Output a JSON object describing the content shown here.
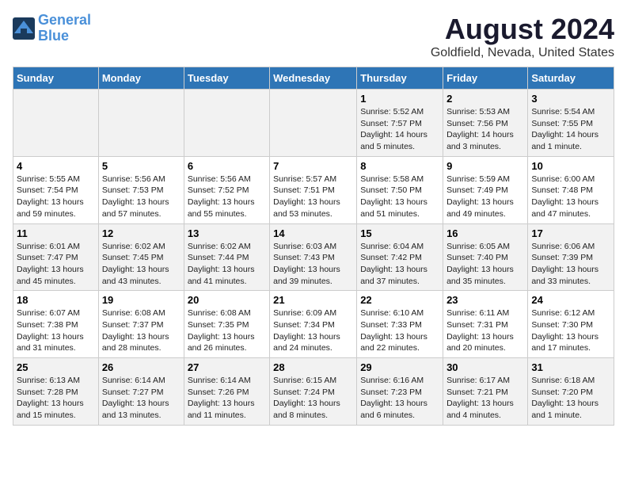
{
  "header": {
    "logo_line1": "General",
    "logo_line2": "Blue",
    "main_title": "August 2024",
    "subtitle": "Goldfield, Nevada, United States"
  },
  "days_of_week": [
    "Sunday",
    "Monday",
    "Tuesday",
    "Wednesday",
    "Thursday",
    "Friday",
    "Saturday"
  ],
  "weeks": [
    [
      {
        "day": "",
        "detail": ""
      },
      {
        "day": "",
        "detail": ""
      },
      {
        "day": "",
        "detail": ""
      },
      {
        "day": "",
        "detail": ""
      },
      {
        "day": "1",
        "detail": "Sunrise: 5:52 AM\nSunset: 7:57 PM\nDaylight: 14 hours\nand 5 minutes."
      },
      {
        "day": "2",
        "detail": "Sunrise: 5:53 AM\nSunset: 7:56 PM\nDaylight: 14 hours\nand 3 minutes."
      },
      {
        "day": "3",
        "detail": "Sunrise: 5:54 AM\nSunset: 7:55 PM\nDaylight: 14 hours\nand 1 minute."
      }
    ],
    [
      {
        "day": "4",
        "detail": "Sunrise: 5:55 AM\nSunset: 7:54 PM\nDaylight: 13 hours\nand 59 minutes."
      },
      {
        "day": "5",
        "detail": "Sunrise: 5:56 AM\nSunset: 7:53 PM\nDaylight: 13 hours\nand 57 minutes."
      },
      {
        "day": "6",
        "detail": "Sunrise: 5:56 AM\nSunset: 7:52 PM\nDaylight: 13 hours\nand 55 minutes."
      },
      {
        "day": "7",
        "detail": "Sunrise: 5:57 AM\nSunset: 7:51 PM\nDaylight: 13 hours\nand 53 minutes."
      },
      {
        "day": "8",
        "detail": "Sunrise: 5:58 AM\nSunset: 7:50 PM\nDaylight: 13 hours\nand 51 minutes."
      },
      {
        "day": "9",
        "detail": "Sunrise: 5:59 AM\nSunset: 7:49 PM\nDaylight: 13 hours\nand 49 minutes."
      },
      {
        "day": "10",
        "detail": "Sunrise: 6:00 AM\nSunset: 7:48 PM\nDaylight: 13 hours\nand 47 minutes."
      }
    ],
    [
      {
        "day": "11",
        "detail": "Sunrise: 6:01 AM\nSunset: 7:47 PM\nDaylight: 13 hours\nand 45 minutes."
      },
      {
        "day": "12",
        "detail": "Sunrise: 6:02 AM\nSunset: 7:45 PM\nDaylight: 13 hours\nand 43 minutes."
      },
      {
        "day": "13",
        "detail": "Sunrise: 6:02 AM\nSunset: 7:44 PM\nDaylight: 13 hours\nand 41 minutes."
      },
      {
        "day": "14",
        "detail": "Sunrise: 6:03 AM\nSunset: 7:43 PM\nDaylight: 13 hours\nand 39 minutes."
      },
      {
        "day": "15",
        "detail": "Sunrise: 6:04 AM\nSunset: 7:42 PM\nDaylight: 13 hours\nand 37 minutes."
      },
      {
        "day": "16",
        "detail": "Sunrise: 6:05 AM\nSunset: 7:40 PM\nDaylight: 13 hours\nand 35 minutes."
      },
      {
        "day": "17",
        "detail": "Sunrise: 6:06 AM\nSunset: 7:39 PM\nDaylight: 13 hours\nand 33 minutes."
      }
    ],
    [
      {
        "day": "18",
        "detail": "Sunrise: 6:07 AM\nSunset: 7:38 PM\nDaylight: 13 hours\nand 31 minutes."
      },
      {
        "day": "19",
        "detail": "Sunrise: 6:08 AM\nSunset: 7:37 PM\nDaylight: 13 hours\nand 28 minutes."
      },
      {
        "day": "20",
        "detail": "Sunrise: 6:08 AM\nSunset: 7:35 PM\nDaylight: 13 hours\nand 26 minutes."
      },
      {
        "day": "21",
        "detail": "Sunrise: 6:09 AM\nSunset: 7:34 PM\nDaylight: 13 hours\nand 24 minutes."
      },
      {
        "day": "22",
        "detail": "Sunrise: 6:10 AM\nSunset: 7:33 PM\nDaylight: 13 hours\nand 22 minutes."
      },
      {
        "day": "23",
        "detail": "Sunrise: 6:11 AM\nSunset: 7:31 PM\nDaylight: 13 hours\nand 20 minutes."
      },
      {
        "day": "24",
        "detail": "Sunrise: 6:12 AM\nSunset: 7:30 PM\nDaylight: 13 hours\nand 17 minutes."
      }
    ],
    [
      {
        "day": "25",
        "detail": "Sunrise: 6:13 AM\nSunset: 7:28 PM\nDaylight: 13 hours\nand 15 minutes."
      },
      {
        "day": "26",
        "detail": "Sunrise: 6:14 AM\nSunset: 7:27 PM\nDaylight: 13 hours\nand 13 minutes."
      },
      {
        "day": "27",
        "detail": "Sunrise: 6:14 AM\nSunset: 7:26 PM\nDaylight: 13 hours\nand 11 minutes."
      },
      {
        "day": "28",
        "detail": "Sunrise: 6:15 AM\nSunset: 7:24 PM\nDaylight: 13 hours\nand 8 minutes."
      },
      {
        "day": "29",
        "detail": "Sunrise: 6:16 AM\nSunset: 7:23 PM\nDaylight: 13 hours\nand 6 minutes."
      },
      {
        "day": "30",
        "detail": "Sunrise: 6:17 AM\nSunset: 7:21 PM\nDaylight: 13 hours\nand 4 minutes."
      },
      {
        "day": "31",
        "detail": "Sunrise: 6:18 AM\nSunset: 7:20 PM\nDaylight: 13 hours\nand 1 minute."
      }
    ]
  ]
}
